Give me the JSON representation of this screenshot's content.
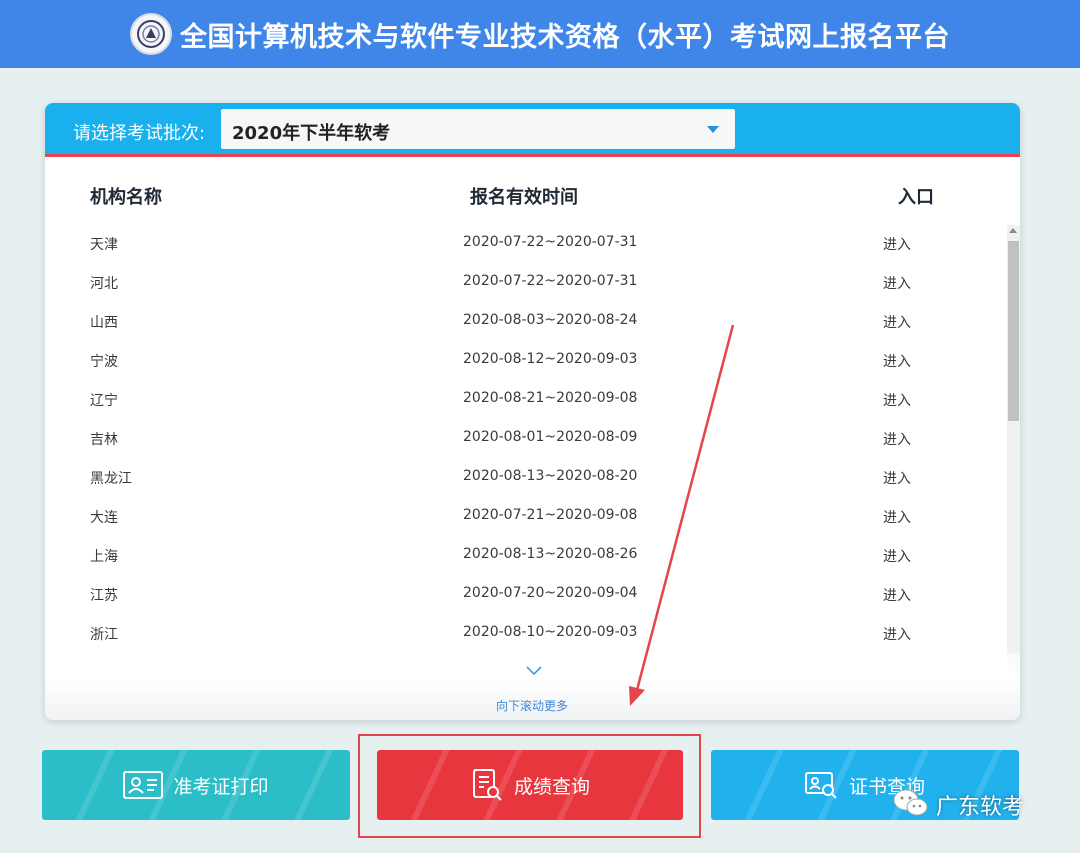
{
  "header": {
    "title": "全国计算机技术与软件专业技术资格（水平）考试网上报名平台"
  },
  "batch": {
    "label": "请选择考试批次:",
    "selected": "2020年下半年软考"
  },
  "table": {
    "columns": {
      "name": "机构名称",
      "time": "报名有效时间",
      "entry": "入口"
    },
    "rows": [
      {
        "name": "天津",
        "time": "2020-07-22~2020-07-31",
        "entry": "进入"
      },
      {
        "name": "河北",
        "time": "2020-07-22~2020-07-31",
        "entry": "进入"
      },
      {
        "name": "山西",
        "time": "2020-08-03~2020-08-24",
        "entry": "进入"
      },
      {
        "name": "宁波",
        "time": "2020-08-12~2020-09-03",
        "entry": "进入"
      },
      {
        "name": "辽宁",
        "time": "2020-08-21~2020-09-08",
        "entry": "进入"
      },
      {
        "name": "吉林",
        "time": "2020-08-01~2020-08-09",
        "entry": "进入"
      },
      {
        "name": "黑龙江",
        "time": "2020-08-13~2020-08-20",
        "entry": "进入"
      },
      {
        "name": "大连",
        "time": "2020-07-21~2020-09-08",
        "entry": "进入"
      },
      {
        "name": "上海",
        "time": "2020-08-13~2020-08-26",
        "entry": "进入"
      },
      {
        "name": "江苏",
        "time": "2020-07-20~2020-09-04",
        "entry": "进入"
      },
      {
        "name": "浙江",
        "time": "2020-08-10~2020-09-03",
        "entry": "进入"
      }
    ],
    "scroll_more": "向下滚动更多"
  },
  "actions": {
    "admit_card": "准考证打印",
    "score_query": "成绩查询",
    "cert_query": "证书查询"
  },
  "watermark": {
    "text": "广东软考"
  },
  "colors": {
    "header_bg": "#3f86e8",
    "batch_bar": "#1ab0ee",
    "admit_btn": "#2bbdc8",
    "score_btn": "#e8363f",
    "cert_btn": "#21b2ee",
    "annotation": "#e3454c"
  }
}
